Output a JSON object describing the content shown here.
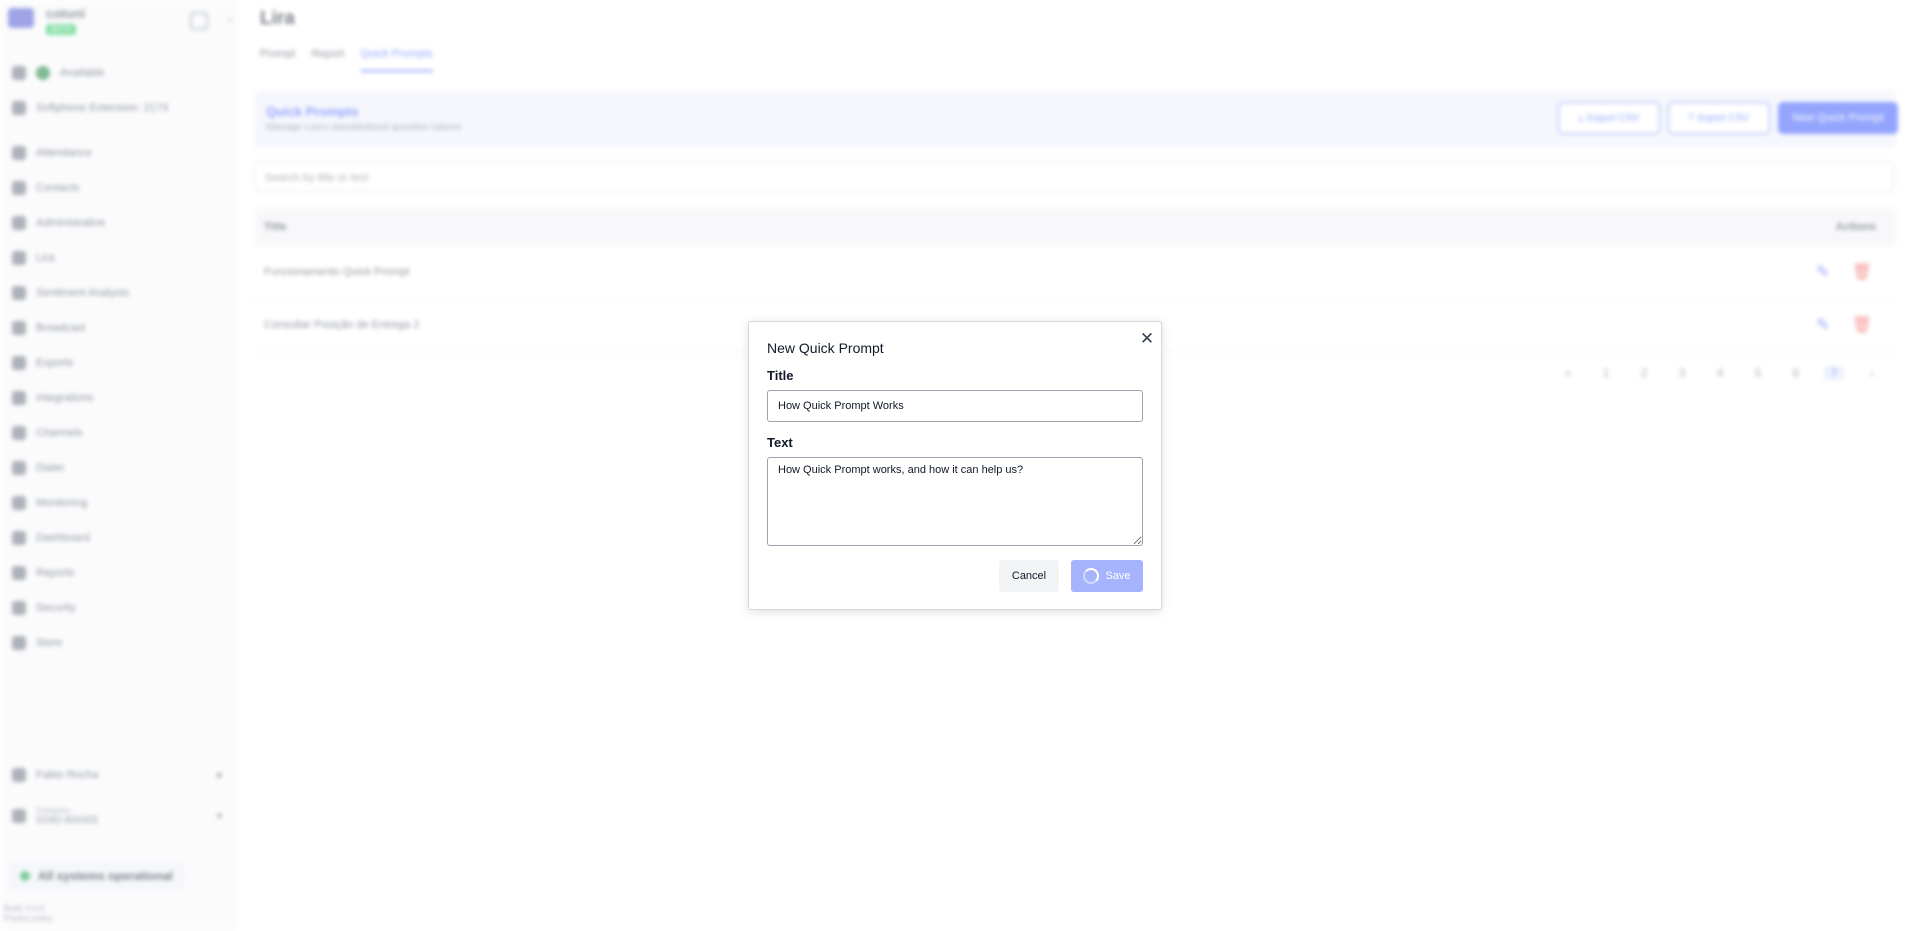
{
  "sidebar": {
    "brand": "cotuni",
    "badge": "BETA",
    "status": "Available",
    "extension": "Softphone Extension: 2173",
    "items": [
      {
        "label": "Attendance",
        "icon": "chat-icon"
      },
      {
        "label": "Contacts",
        "icon": "contacts-icon"
      },
      {
        "label": "Administrative",
        "icon": "admin-icon"
      },
      {
        "label": "Lira",
        "icon": "lira-icon"
      },
      {
        "label": "Sentiment Analysis",
        "icon": "heart-icon"
      },
      {
        "label": "Broadcast",
        "icon": "broadcast-icon"
      },
      {
        "label": "Exports",
        "icon": "export-icon"
      },
      {
        "label": "Integrations",
        "icon": "integrations-icon"
      },
      {
        "label": "Channels",
        "icon": "channels-icon"
      },
      {
        "label": "Dialer",
        "icon": "dialer-icon"
      },
      {
        "label": "Monitoring",
        "icon": "monitoring-icon"
      },
      {
        "label": "Dashboard",
        "icon": "dashboard-icon"
      },
      {
        "label": "Reports",
        "icon": "reports-icon"
      },
      {
        "label": "Security",
        "icon": "key-icon"
      },
      {
        "label": "Store",
        "icon": "store-icon"
      }
    ],
    "user": "Fabio Rocha",
    "company_label": "Company",
    "company_name": "GOID ADGEE",
    "system_status": "All systems operational",
    "version_line1": "Build: 0.0.0",
    "version_line2": "Privacy policy"
  },
  "page": {
    "title": "Lira",
    "tabs": [
      "Prompt",
      "Report",
      "Quick Prompts"
    ],
    "active_tab": "Quick Prompts"
  },
  "quick_prompts": {
    "title": "Quick Prompts",
    "subtitle": "Manage Lira's standardized question tokens",
    "export_label": "Export CSV",
    "import_label": "Import CSV",
    "new_label": "New Quick Prompt",
    "search_placeholder": "Search by title or text",
    "columns": {
      "title": "Title",
      "actions": "Actions"
    },
    "rows": [
      {
        "title": "Funcionamento Quick Prompt"
      },
      {
        "title": "Consultar Posição de Entrega 2"
      }
    ],
    "pagination": [
      "1",
      "2",
      "3",
      "4",
      "5",
      "6",
      "7"
    ],
    "current_page": "7"
  },
  "modal": {
    "title": "New Quick Prompt",
    "title_label": "Title",
    "title_value": "How Quick Prompt Works",
    "text_label": "Text",
    "text_value": "How Quick Prompt works, and how it can help us?",
    "cancel_label": "Cancel",
    "save_label": "Save",
    "save_loading": true
  },
  "colors": {
    "accent": "#3b5bfd",
    "danger": "#ef4444",
    "save_disabled": "#a5b4fc",
    "status_ok": "#16a34a"
  }
}
